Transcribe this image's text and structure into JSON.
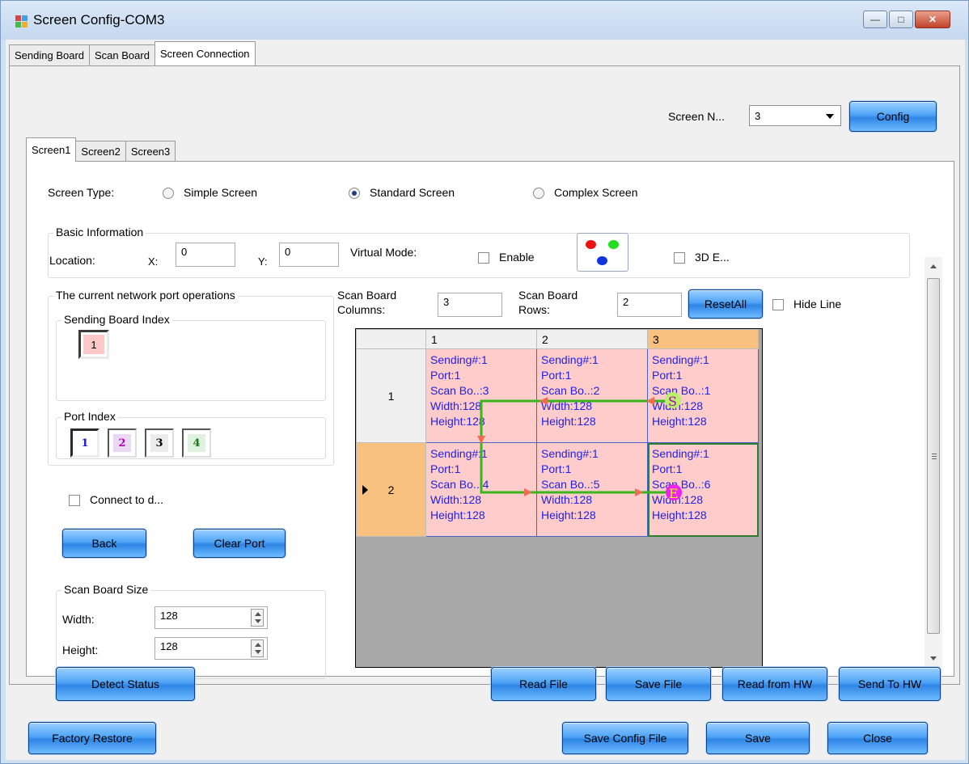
{
  "window": {
    "title": "Screen Config-COM3",
    "controls": [
      "minimize-icon",
      "maximize-icon",
      "close-icon"
    ]
  },
  "top_tabs": [
    {
      "label": "Sending Board",
      "active": false
    },
    {
      "label": "Scan Board",
      "active": false
    },
    {
      "label": "Screen Connection",
      "active": true
    }
  ],
  "screen_number": {
    "label": "Screen N...",
    "value": "3",
    "config_label": "Config"
  },
  "screen_tabs": [
    {
      "label": "Screen1",
      "active": true
    },
    {
      "label": "Screen2",
      "active": false
    },
    {
      "label": "Screen3",
      "active": false
    }
  ],
  "screen_type": {
    "label": "Screen Type:",
    "options": [
      {
        "label": "Simple Screen",
        "checked": false
      },
      {
        "label": "Standard Screen",
        "checked": true
      },
      {
        "label": "Complex Screen",
        "checked": false
      }
    ]
  },
  "basic_info": {
    "title": "Basic Information",
    "location_label": "Location:",
    "x_label": "X:",
    "x_value": "0",
    "y_label": "Y:",
    "y_value": "0",
    "virtual_mode_label": "Virtual Mode:",
    "enable_label": "Enable",
    "three_d_label": "3D E..."
  },
  "network_port": {
    "title": "The current network port operations",
    "sending_board_index_label": "Sending Board Index",
    "sending_board_index": "1",
    "port_index_label": "Port Index",
    "ports": [
      {
        "label": "1",
        "color": "#1a1ae0",
        "active": true
      },
      {
        "label": "2",
        "color": "#b000b0",
        "active": false
      },
      {
        "label": "3",
        "color": "#000000",
        "active": false
      },
      {
        "label": "4",
        "color": "#1a7a1a",
        "active": false
      }
    ],
    "connect_label": "Connect to d...",
    "back_label": "Back",
    "clear_port_label": "Clear Port"
  },
  "scan_board_size": {
    "title": "Scan Board Size",
    "width_label": "Width:",
    "width_value": "128",
    "height_label": "Height:",
    "height_value": "128"
  },
  "grid_controls": {
    "columns_label_1": "Scan Board",
    "columns_label_2": "Columns:",
    "columns_value": "3",
    "rows_label_1": "Scan Board",
    "rows_label_2": "Rows:",
    "rows_value": "2",
    "reset_all_label": "ResetAll",
    "hide_line_label": "Hide Line"
  },
  "grid": {
    "col_headers": [
      "1",
      "2",
      "3"
    ],
    "row_headers": [
      "1",
      "2"
    ],
    "cells": [
      [
        [
          "Sending#:1",
          "Port:1",
          "Scan Bo..:3",
          "Width:128",
          "Height:128"
        ],
        [
          "Sending#:1",
          "Port:1",
          "Scan Bo..:2",
          "Width:128",
          "Height:128"
        ],
        [
          "Sending#:1",
          "Port:1",
          "Scan Bo..:1",
          "Width:128",
          "Height:128"
        ]
      ],
      [
        [
          "Sending#:1",
          "Port:1",
          "Scan Bo..:4",
          "Width:128",
          "Height:128"
        ],
        [
          "Sending#:1",
          "Port:1",
          "Scan Bo..:5",
          "Width:128",
          "Height:128"
        ],
        [
          "Sending#:1",
          "Port:1",
          "Scan Bo..:6",
          "Width:128",
          "Height:128"
        ]
      ]
    ],
    "start_marker": "S",
    "end_marker": "E",
    "route_color": "#37b71c",
    "arrow_color": "#f26a4f"
  },
  "bottom_buttons": {
    "detect_status": "Detect Status",
    "read_file": "Read File",
    "save_file": "Save File",
    "read_from_hw": "Read from HW",
    "send_to_hw": "Send To HW",
    "factory_restore": "Factory Restore",
    "save_config_file": "Save Config File",
    "save": "Save",
    "close": "Close"
  }
}
